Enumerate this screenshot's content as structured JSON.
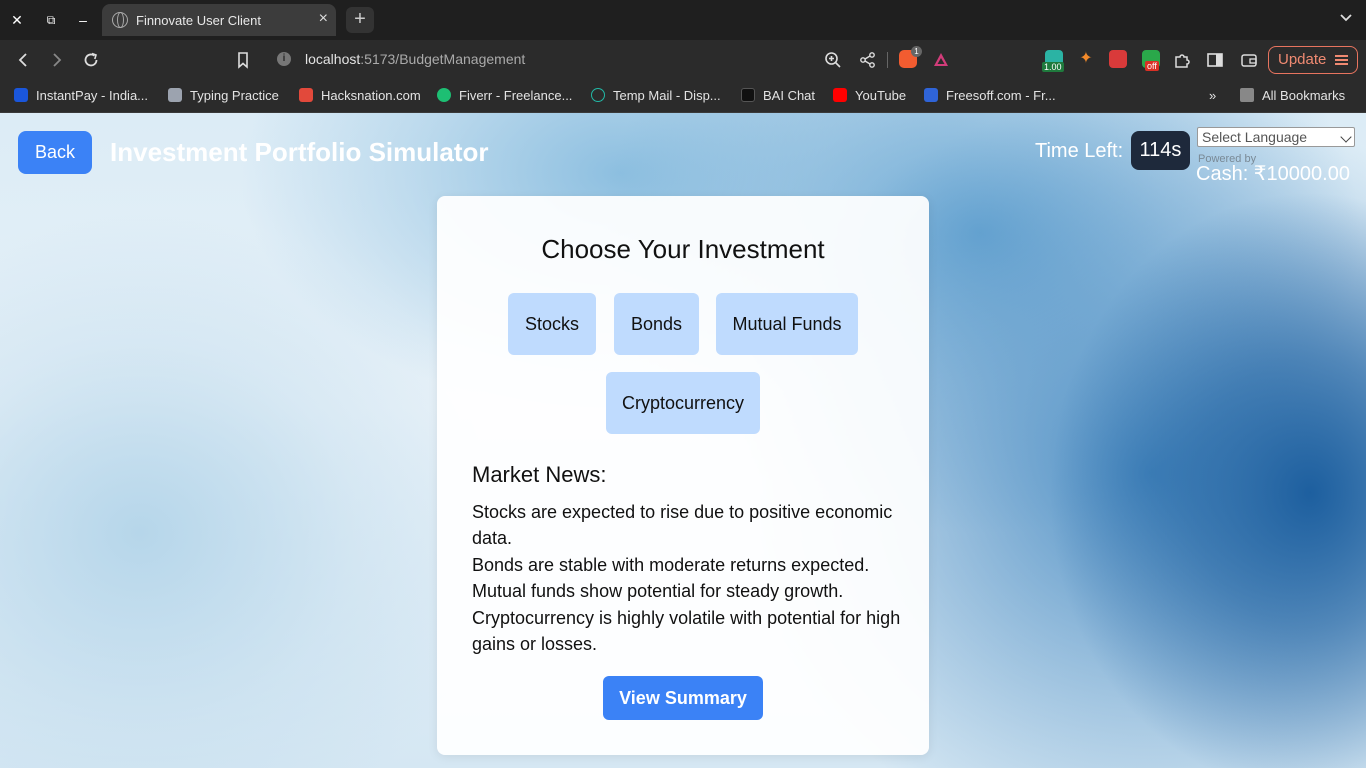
{
  "browser": {
    "tab_title": "Finnovate User Client",
    "url_host": "localhost",
    "url_path": ":5173/BudgetManagement",
    "ext_badge": "1.00",
    "ext_off_badge": "off",
    "brave_badge": "1",
    "update_label": "Update",
    "bookmarks": [
      {
        "label": "InstantPay - India...",
        "icon": "instantpay-icon",
        "color": "#1a56db"
      },
      {
        "label": "Typing Practice",
        "icon": "typing-icon",
        "color": "#9ca3af"
      },
      {
        "label": "Hacksnation.com",
        "icon": "hacksnation-icon",
        "color": "#e2493b"
      },
      {
        "label": "Fiverr - Freelance...",
        "icon": "fiverr-icon",
        "color": "#1dbf73"
      },
      {
        "label": "Temp Mail - Disp...",
        "icon": "tempmail-icon",
        "color": "#22b8a6"
      },
      {
        "label": "BAI Chat",
        "icon": "baichat-icon",
        "color": "#111111"
      },
      {
        "label": "YouTube",
        "icon": "youtube-icon",
        "color": "#ff0000"
      },
      {
        "label": "Freesoff.com - Fr...",
        "icon": "freesoff-icon",
        "color": "#2f64d8"
      }
    ],
    "all_bookmarks_label": "All Bookmarks"
  },
  "header": {
    "back_label": "Back",
    "title": "Investment Portfolio Simulator",
    "time_left_label": "Time Left:",
    "time_left_value": "114s",
    "language_select": "Select Language",
    "powered_by": "Powered by",
    "cash": "Cash: ₹10000.00"
  },
  "main": {
    "title": "Choose Your Investment",
    "options": [
      "Stocks",
      "Bonds",
      "Mutual Funds",
      "Cryptocurrency"
    ],
    "news_title": "Market News:",
    "news": [
      "Stocks are expected to rise due to positive economic data.",
      "Bonds are stable with moderate returns expected.",
      "Mutual funds show potential for steady growth.",
      "Cryptocurrency is highly volatile with potential for high gains or losses."
    ],
    "summary_label": "View Summary"
  },
  "colors": {
    "primary": "#3b82f6",
    "option_bg": "#bfdbfe",
    "timer_bg": "#1e293b"
  }
}
